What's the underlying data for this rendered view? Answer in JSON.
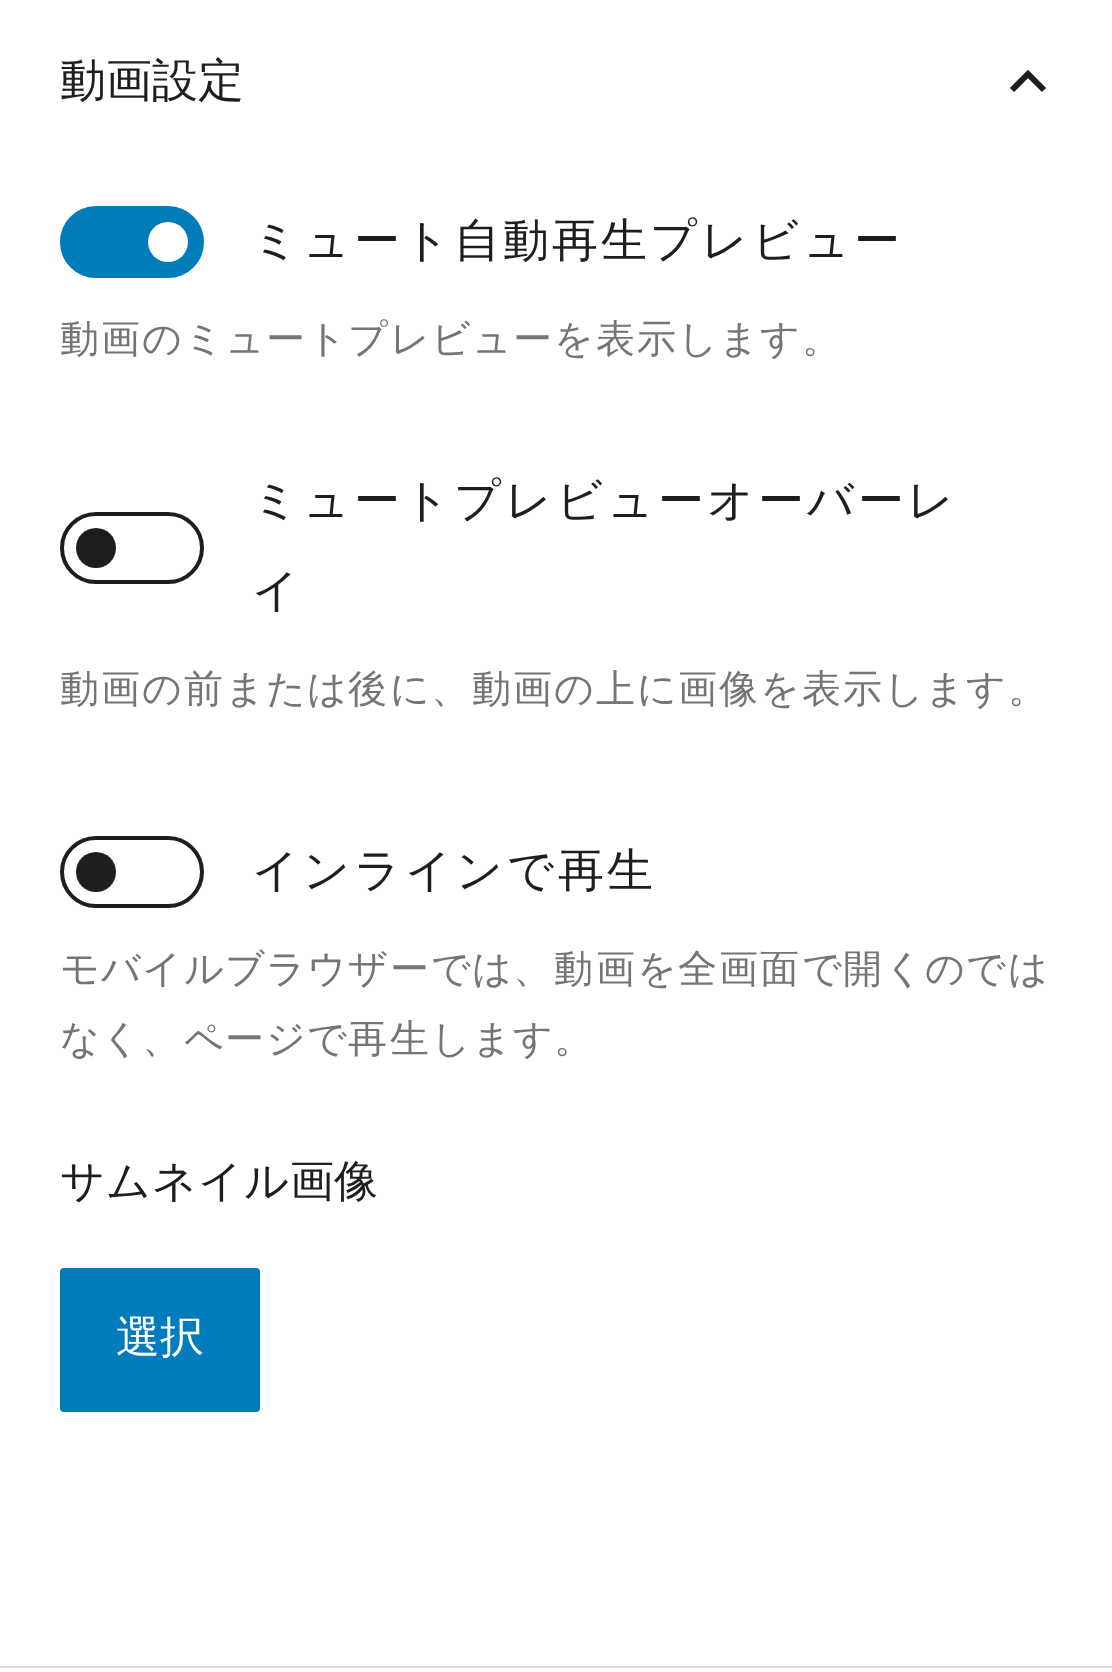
{
  "panel": {
    "title": "動画設定",
    "expanded": true
  },
  "settings": [
    {
      "label": "ミュート自動再生プレビュー",
      "on": true,
      "help": "動画のミュートプレビューを表示します。"
    },
    {
      "label": "ミュートプレビューオーバーレイ",
      "on": false,
      "help": "動画の前または後に、動画の上に画像を表示します。"
    },
    {
      "label": "インラインで再生",
      "on": false,
      "help": "モバイルブラウザーでは、動画を全画面で開くのではなく、ページで再生します。"
    }
  ],
  "thumbnail": {
    "heading": "サムネイル画像",
    "button": "選択"
  }
}
